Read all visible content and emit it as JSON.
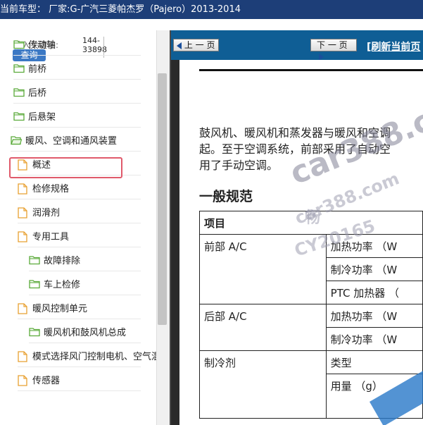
{
  "window": {
    "title": "当前车型： 厂家:G-广汽三菱帕杰罗（Pajero）2013-2014"
  },
  "search": {
    "label": "输入关键字:",
    "value": "144-33898",
    "button": "查询"
  },
  "tree": [
    {
      "label": "传动轴",
      "type": "folder"
    },
    {
      "label": "前桥",
      "type": "folder"
    },
    {
      "label": "后桥",
      "type": "folder"
    },
    {
      "label": "后悬架",
      "type": "folder"
    },
    {
      "label": "暖风、空调和通风装置",
      "type": "folder-open",
      "selected": true
    },
    {
      "label": "概述",
      "type": "doc"
    },
    {
      "label": "检修规格",
      "type": "doc"
    },
    {
      "label": "润滑剂",
      "type": "doc"
    },
    {
      "label": "专用工具",
      "type": "doc"
    },
    {
      "label": "故障排除",
      "type": "folder"
    },
    {
      "label": "车上检修",
      "type": "folder"
    },
    {
      "label": "暖风控制单元",
      "type": "doc"
    },
    {
      "label": "暖风机和鼓风机总成",
      "type": "folder"
    },
    {
      "label": "模式选择风门控制电机、空气混",
      "type": "doc"
    },
    {
      "label": "传感器",
      "type": "doc"
    }
  ],
  "viewer": {
    "prev_label": "上 一 页",
    "next_label": "下 一 页",
    "refresh_label": "[刷新当前页"
  },
  "document": {
    "paragraph": [
      "鼓风机、暖风机和蒸发器与暖风和空调",
      "起。至于空调系统，前部采用了自动空",
      "用了手动空调。"
    ],
    "heading": "一般规范",
    "table": {
      "header": "项目",
      "front_ac": "前部 A/C",
      "rear_ac": "后部 A/C",
      "refrigerant": "制冷剂",
      "heating_power": "加热功率 （W",
      "cooling_power": "制冷功率 （W",
      "ptc_heater": "PTC 加热器 （",
      "rear_heating_power": "加热功率 （W",
      "rear_cooling_power": "制冷功率 （W",
      "type": "类型",
      "amount": "用量 （g）"
    }
  },
  "watermark": {
    "big": "car388.com",
    "small": "car388.com",
    "cn": "畅",
    "code": "CY20165"
  },
  "colors": {
    "titlebar": "#1d3e78",
    "navbar": "#0f5e95",
    "selection": "#e05a6b",
    "folder": "#5aaa3a",
    "doc": "#e8a030"
  }
}
